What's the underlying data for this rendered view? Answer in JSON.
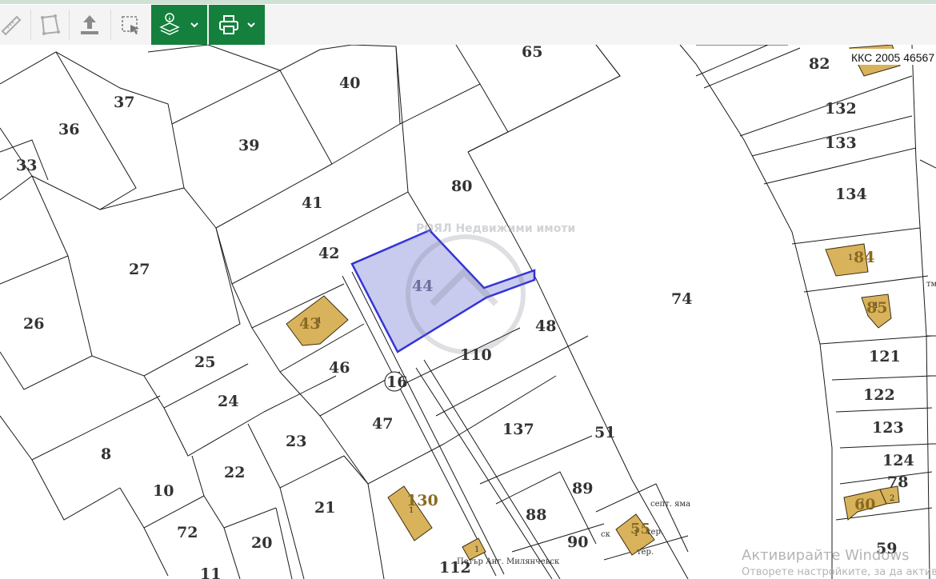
{
  "map": {
    "parcels": [
      "65",
      "82",
      "40",
      "37",
      "36",
      "39",
      "33",
      "132",
      "133",
      "80",
      "134",
      "41",
      "42",
      "27",
      "84",
      "74",
      "44",
      "85",
      "43",
      "26",
      "48",
      "25",
      "110",
      "121",
      "46",
      "16",
      "24",
      "122",
      "47",
      "23",
      "137",
      "51",
      "123",
      "8",
      "124",
      "22",
      "10",
      "21",
      "78",
      "89",
      "130",
      "88",
      "60",
      "72",
      "20",
      "90",
      "59",
      "112",
      "11"
    ],
    "cadastre_code": "ККС 2005 46567",
    "street_name": "Петър Анг. Милянчевск",
    "notes": [
      "септ. яма",
      "тер.",
      "тер.",
      "ск",
      "тм"
    ],
    "building_floors": [
      "1",
      "1",
      "1",
      "1",
      "1",
      "1",
      "1",
      "2",
      "1"
    ],
    "selection_color": "#2b2bd6",
    "selection_fill": "#c7c9ee",
    "building_color": "#d9b25c",
    "watermark_text": "РОЯЛ Недвижими имоти"
  },
  "toolbar": {
    "tools": [
      "ruler-icon",
      "polygon-measure-icon",
      "upload-icon",
      "select-area-icon",
      "layers-info-icon",
      "print-icon"
    ],
    "accent": "#15803d"
  },
  "os_watermark": {
    "line1": "Активирайте Windows",
    "line2": "Отворете настройките, за да активи"
  }
}
